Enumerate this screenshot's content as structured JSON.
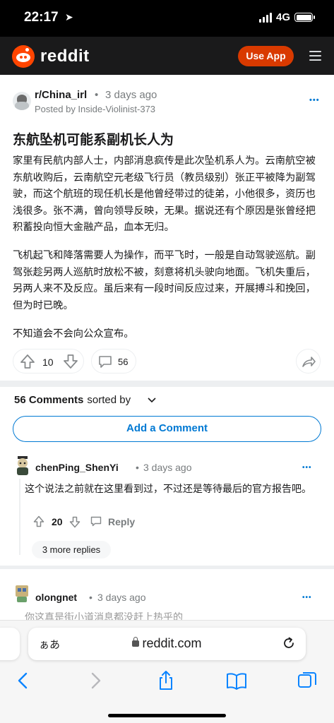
{
  "status_bar": {
    "time": "22:17",
    "network": "4G"
  },
  "header": {
    "logo_text": "reddit",
    "use_app": "Use App"
  },
  "post": {
    "subreddit": "r/China_irl",
    "separator": "•",
    "age": "3 days ago",
    "posted_by": "Posted by Inside-Violinist-373",
    "more": "•••",
    "title": "东航坠机可能系副机长人为",
    "paragraphs": [
      "家里有民航内部人士，内部消息疯传是此次坠机系人为。云南航空被东航收购后，云南航空元老级飞行员（教员级别）张正平被降为副驾驶，而这个航班的现任机长是他曾经带过的徒弟，小他很多，资历也浅很多。张不满，曾向领导反映，无果。据说还有个原因是张曾经把积蓄投向恒大金融产品，血本无归。",
      "飞机起飞和降落需要人为操作，而平飞时，一般是自动驾驶巡航。副驾张趁另两人巡航时放松不被，刻意将机头驶向地面。飞机失重后，另两人来不及反应。虽后来有一段时间反应过来，开展搏斗和挽回，但为时已晚。",
      "不知道会不会向公众宣布。"
    ],
    "score": "10",
    "comment_count": "56"
  },
  "comments_section": {
    "count_label": "56 Comments",
    "sorted_by": "sorted by",
    "add_comment": "Add a Comment"
  },
  "comments": [
    {
      "user": "chenPing_ShenYi",
      "separator": "•",
      "age": "3 days ago",
      "more": "•••",
      "text": "这个说法之前就在这里看到过，不过还是等待最后的官方报告吧。",
      "score": "20",
      "reply": "Reply",
      "more_replies": "3 more replies"
    },
    {
      "user": "olongnet",
      "separator": "•",
      "age": "3 days ago",
      "more": "•••",
      "text": "你这真是街小道消息都没赶上热乎的"
    }
  ],
  "safari": {
    "text_size": "ぁあ",
    "url": "reddit.com"
  }
}
